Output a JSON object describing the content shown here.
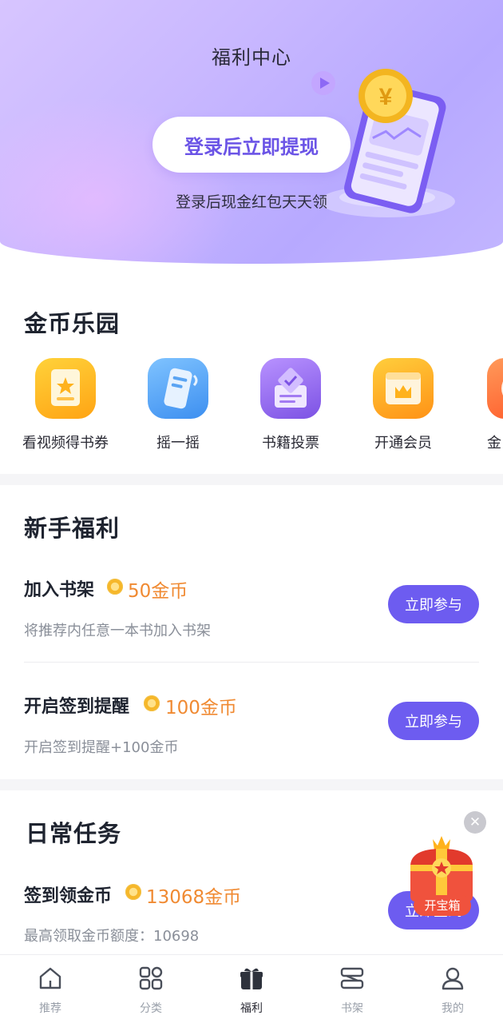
{
  "header": {
    "title": "福利中心",
    "login_button": "登录后立即提现",
    "login_subtitle": "登录后现金红包天天领"
  },
  "coin_park": {
    "title": "金币乐园",
    "items": [
      {
        "label": "看视频得书券",
        "icon": "ticket-star-icon",
        "color": "#ffb21c"
      },
      {
        "label": "摇一摇",
        "icon": "phone-shake-icon",
        "color": "#4a9df0"
      },
      {
        "label": "书籍投票",
        "icon": "vote-box-icon",
        "color": "#8b62e8"
      },
      {
        "label": "开通会员",
        "icon": "crown-card-icon",
        "color": "#ffa21a"
      },
      {
        "label": "金",
        "icon": "coin-icon",
        "color": "#ff6a3a"
      }
    ]
  },
  "newbie": {
    "title": "新手福利",
    "tasks": [
      {
        "title": "加入书架",
        "reward": "50金币",
        "desc": "将推荐内任意一本书加入书架",
        "button": "立即参与"
      },
      {
        "title": "开启签到提醒",
        "reward": "100金币",
        "desc": "开启签到提醒+100金币",
        "button": "立即参与"
      }
    ]
  },
  "daily": {
    "title": "日常任务",
    "tasks": [
      {
        "title": "签到领金币",
        "reward": "13068金币",
        "desc": "最高领取金币额度：10698",
        "button": "立即签到"
      }
    ]
  },
  "treasure": {
    "label": "开宝箱",
    "close_symbol": "✕"
  },
  "bottom_nav": {
    "items": [
      {
        "label": "推荐",
        "icon": "home-icon",
        "active": false
      },
      {
        "label": "分类",
        "icon": "grid-icon",
        "active": false
      },
      {
        "label": "福利",
        "icon": "gift-icon",
        "active": true
      },
      {
        "label": "书架",
        "icon": "bookshelf-icon",
        "active": false
      },
      {
        "label": "我的",
        "icon": "user-icon",
        "active": false
      }
    ]
  },
  "colors": {
    "accent": "#6d5cf0",
    "reward": "#f08a32",
    "treasure_red": "#f0523d"
  }
}
